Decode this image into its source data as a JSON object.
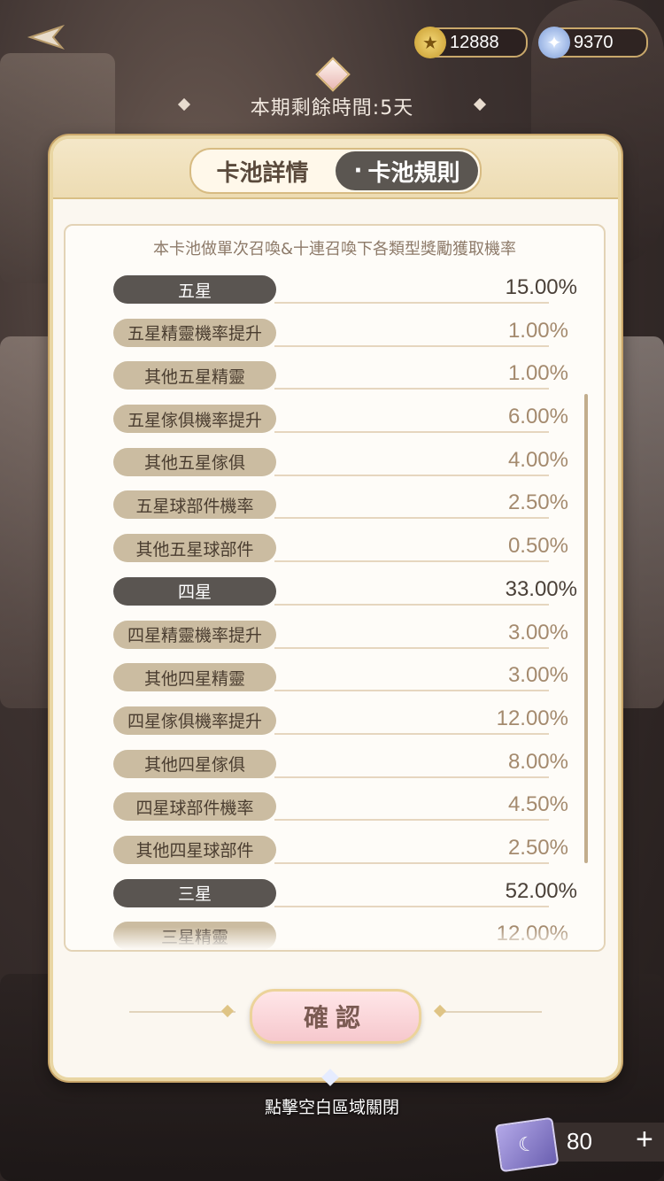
{
  "header": {
    "back_icon": "back-arrow-icon",
    "currencies": [
      {
        "name": "gold-coin",
        "icon": "★",
        "value": "12888"
      },
      {
        "name": "diamond",
        "icon": "✦",
        "value": "9370"
      }
    ],
    "period_text": "本期剩餘時間:5天"
  },
  "modal": {
    "tabs": [
      {
        "label": "卡池詳情",
        "active": false
      },
      {
        "label": "卡池規則",
        "active": true,
        "prefix": "·"
      }
    ],
    "intro": "本卡池做單次召喚&十連召喚下各類型獎勵獲取機率",
    "rows": [
      {
        "type": "head",
        "label": "五星",
        "value": "15.00%"
      },
      {
        "type": "sub",
        "label": "五星精靈機率提升",
        "value": "1.00%"
      },
      {
        "type": "sub",
        "label": "其他五星精靈",
        "value": "1.00%"
      },
      {
        "type": "sub",
        "label": "五星傢俱機率提升",
        "value": "6.00%"
      },
      {
        "type": "sub",
        "label": "其他五星傢俱",
        "value": "4.00%"
      },
      {
        "type": "sub",
        "label": "五星球部件機率",
        "value": "2.50%"
      },
      {
        "type": "sub",
        "label": "其他五星球部件",
        "value": "0.50%"
      },
      {
        "type": "head",
        "label": "四星",
        "value": "33.00%"
      },
      {
        "type": "sub",
        "label": "四星精靈機率提升",
        "value": "3.00%"
      },
      {
        "type": "sub",
        "label": "其他四星精靈",
        "value": "3.00%"
      },
      {
        "type": "sub",
        "label": "四星傢俱機率提升",
        "value": "12.00%"
      },
      {
        "type": "sub",
        "label": "其他四星傢俱",
        "value": "8.00%"
      },
      {
        "type": "sub",
        "label": "四星球部件機率",
        "value": "4.50%"
      },
      {
        "type": "sub",
        "label": "其他四星球部件",
        "value": "2.50%"
      },
      {
        "type": "head",
        "label": "三星",
        "value": "52.00%"
      },
      {
        "type": "sub",
        "label": "三星精靈",
        "value": "12.00%"
      }
    ],
    "confirm_label": "確認"
  },
  "close_hint": "點擊空白區域關閉",
  "ticket": {
    "icon": "☾",
    "count": "80",
    "plus": "+"
  }
}
